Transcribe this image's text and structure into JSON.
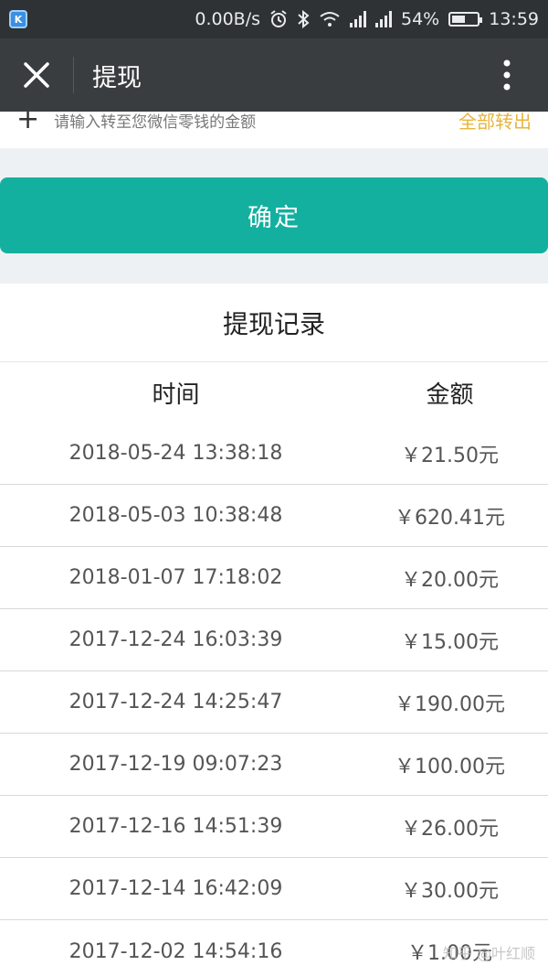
{
  "status_bar": {
    "app_badge": "K",
    "net_speed": "0.00B/s",
    "battery": "54%",
    "battery_level": 0.54,
    "time": "13:59"
  },
  "nav": {
    "title": "提现"
  },
  "input_row": {
    "plus": "+",
    "hint": "请输入转至您微信零钱的金额",
    "all_label": "全部转出"
  },
  "confirm_label": "确定",
  "records": {
    "title": "提现记录",
    "headers": {
      "time": "时间",
      "amount": "金额"
    },
    "rows": [
      {
        "time": "2018-05-24 13:38:18",
        "amount": "￥21.50元"
      },
      {
        "time": "2018-05-03 10:38:48",
        "amount": "￥620.41元"
      },
      {
        "time": "2018-01-07 17:18:02",
        "amount": "￥20.00元"
      },
      {
        "time": "2017-12-24 16:03:39",
        "amount": "￥15.00元"
      },
      {
        "time": "2017-12-24 14:25:47",
        "amount": "￥190.00元"
      },
      {
        "time": "2017-12-19 09:07:23",
        "amount": "￥100.00元"
      },
      {
        "time": "2017-12-16 14:51:39",
        "amount": "￥26.00元"
      },
      {
        "time": "2017-12-14 16:42:09",
        "amount": "￥30.00元"
      },
      {
        "time": "2017-12-02 14:54:16",
        "amount": "￥1.00元"
      }
    ]
  },
  "watermark": "知乎 @叶红顺",
  "icons": {
    "close": "close-icon",
    "more": "more-vertical-icon",
    "alarm": "alarm-icon",
    "bluetooth": "bluetooth-icon",
    "wifi": "wifi-icon",
    "signal": "signal-icon",
    "battery": "battery-icon"
  },
  "colors": {
    "status_bar": "#2e3234",
    "nav_bar": "#3a3d3f",
    "confirm_button": "#13b0a0",
    "link_accent": "#e8b43b",
    "page_background": "#eef1f4"
  }
}
